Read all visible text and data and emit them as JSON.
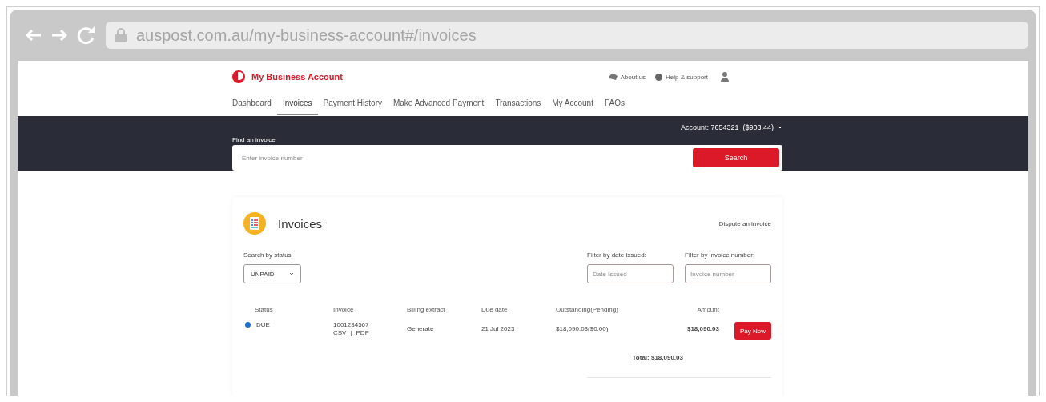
{
  "browser": {
    "url": "auspost.com.au/my-business-account#/invoices"
  },
  "header": {
    "brand": "My Business Account",
    "links": [
      "About us",
      "Help & support"
    ]
  },
  "nav": [
    {
      "label": "Dashboard",
      "selected": false
    },
    {
      "label": "Invoices",
      "selected": true
    },
    {
      "label": "Payment History",
      "selected": false
    },
    {
      "label": "Make Advanced Payment",
      "selected": false
    },
    {
      "label": "Transactions",
      "selected": false
    },
    {
      "label": "My Account",
      "selected": false
    },
    {
      "label": "FAQs",
      "selected": false
    }
  ],
  "account": "Account: 7654321  ($903.44)",
  "search": {
    "label": "Find an invoice",
    "placeholder": "Enter invoice number",
    "button": "Search"
  },
  "invoices": {
    "title": "Invoices",
    "dispute_link": "Dispute an invoice",
    "status_filter": {
      "label": "Search by status:",
      "value": "UNPAID"
    },
    "date_filter": {
      "label": "Filter by date issued:",
      "placeholder": "Date Issued"
    },
    "number_filter": {
      "label": "Filter by invoice number:",
      "placeholder": "Invoice number"
    },
    "columns": [
      "Status",
      "Invoice",
      "Billing extract",
      "Due date",
      "Outstanding(Pending)",
      "Amount"
    ],
    "rows": [
      {
        "status": "DUE",
        "color": "#1e6fd0",
        "invoice": "1001234567",
        "csv": "CSV",
        "separator": "|",
        "pdf": "PDF",
        "billing": "Generate",
        "due": "21 Jul 2023",
        "outstanding": "$18,090.03($0.00)",
        "amount": "$18,090.03",
        "action": "Pay Now"
      }
    ],
    "total": "Total: $18,090.03"
  }
}
